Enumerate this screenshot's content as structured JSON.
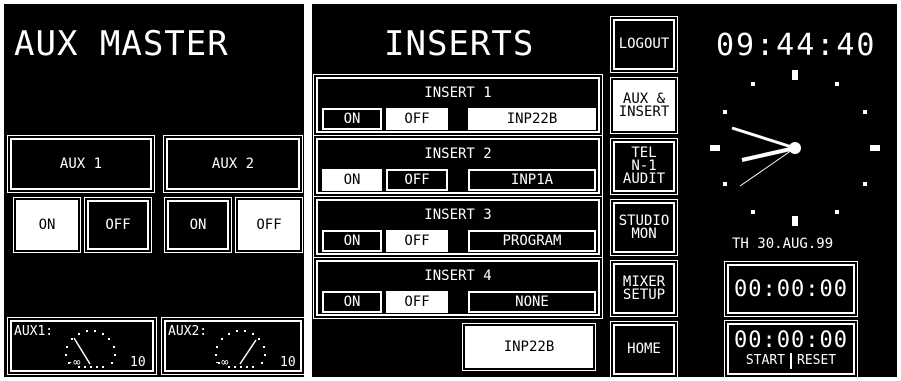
{
  "aux_master": {
    "title": "AUX MASTER",
    "aux1": {
      "label": "AUX 1",
      "on": "ON",
      "off": "OFF",
      "state": "on"
    },
    "aux2": {
      "label": "AUX 2",
      "on": "ON",
      "off": "OFF",
      "state": "off"
    },
    "meter1": {
      "label": "AUX1:",
      "min": "-∞",
      "max": "10"
    },
    "meter2": {
      "label": "AUX2:",
      "min": "-∞",
      "max": "10"
    }
  },
  "inserts": {
    "title": "INSERTS",
    "items": [
      {
        "label": "INSERT 1",
        "on": "ON",
        "off": "OFF",
        "state": "off",
        "source": "INP22B",
        "source_lit": true
      },
      {
        "label": "INSERT 2",
        "on": "ON",
        "off": "OFF",
        "state": "on",
        "source": "INP1A",
        "source_lit": false
      },
      {
        "label": "INSERT 3",
        "on": "ON",
        "off": "OFF",
        "state": "off",
        "source": "PROGRAM",
        "source_lit": false
      },
      {
        "label": "INSERT 4",
        "on": "ON",
        "off": "OFF",
        "state": "off",
        "source": "NONE",
        "source_lit": false
      }
    ],
    "selected_source": "INP22B"
  },
  "sidebar": {
    "logout": "LOGOUT",
    "aux_insert": [
      "AUX &",
      "INSERT"
    ],
    "tel": [
      "TEL",
      "N-1",
      "AUDIT"
    ],
    "studio": [
      "STUDIO",
      "MON"
    ],
    "mixer": [
      "MIXER",
      "SETUP"
    ],
    "home": "HOME"
  },
  "clock": {
    "time": "09:44:40",
    "date": "TH 30.AUG.99",
    "timer1": "00:00:00",
    "timer2": "00:00:00",
    "start": "START",
    "reset": "RESET"
  },
  "colors": {
    "background": "#000000",
    "foreground": "#ffffff",
    "frame": "#ffffff"
  }
}
